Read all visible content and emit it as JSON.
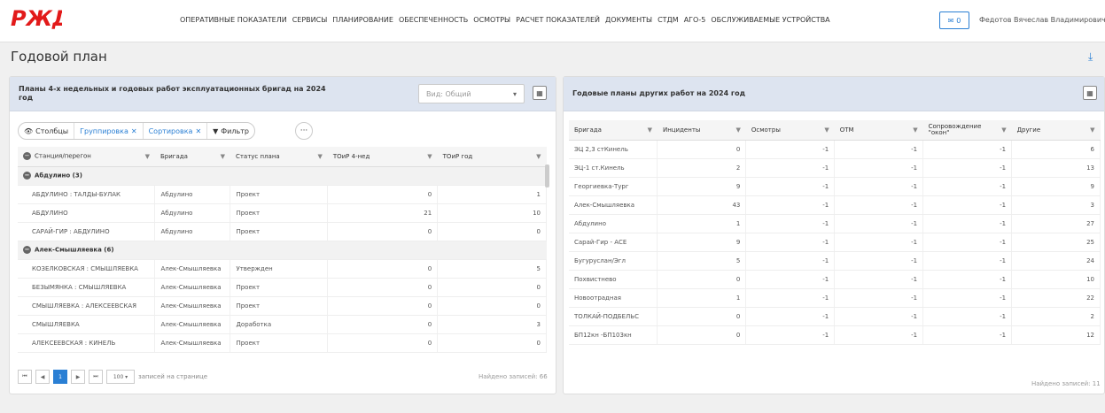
{
  "header": {
    "logo_text": "РЖД",
    "nav": [
      "ОПЕРАТИВНЫЕ ПОКАЗАТЕЛИ",
      "СЕРВИСЫ",
      "ПЛАНИРОВАНИЕ",
      "ОБЕСПЕЧЕННОСТЬ",
      "ОСМОТРЫ",
      "РАСЧЕТ ПОКАЗАТЕЛЕЙ",
      "ДОКУМЕНТЫ",
      "СТДМ",
      "АГО-5",
      "ОБСЛУЖИВАЕМЫЕ УСТРОЙСТВА"
    ],
    "mail_count": "0",
    "user": "Федотов Вячеслав Владимирович"
  },
  "page": {
    "title": "Годовой план"
  },
  "left": {
    "title": "Планы 4-х недельных и годовых работ эксплуатационных бригад на 2024 год",
    "view_placeholder": "Вид: Общий",
    "toolbar": {
      "columns": "Столбцы",
      "grouping": "Группировка",
      "sorting": "Сортировка",
      "filter": "Фильтр",
      "more": "···"
    },
    "headers": [
      "Станция/перегон",
      "Бригада",
      "Статус плана",
      "ТОиР 4-нед",
      "ТОиР год"
    ],
    "groups": [
      {
        "label": "Абдулино (3)",
        "rows": [
          [
            "АБДУЛИНО : ТАЛДЫ-БУЛАК",
            "Абдулино",
            "Проект",
            "0",
            "1"
          ],
          [
            "АБДУЛИНО",
            "Абдулино",
            "Проект",
            "21",
            "10"
          ],
          [
            "САРАЙ-ГИР : АБДУЛИНО",
            "Абдулино",
            "Проект",
            "0",
            "0"
          ]
        ]
      },
      {
        "label": "Алек-Смышляевка (6)",
        "rows": [
          [
            "КОЗЕЛКОВСКАЯ : СМЫШЛЯЕВКА",
            "Алек-Смышляевка",
            "Утвержден",
            "0",
            "5"
          ],
          [
            "БЕЗЫМЯНКА : СМЫШЛЯЕВКА",
            "Алек-Смышляевка",
            "Проект",
            "0",
            "0"
          ],
          [
            "СМЫШЛЯЕВКА : АЛЕКСЕЕВСКАЯ",
            "Алек-Смышляевка",
            "Проект",
            "0",
            "0"
          ],
          [
            "СМЫШЛЯЕВКА",
            "Алек-Смышляевка",
            "Доработка",
            "0",
            "3"
          ],
          [
            "АЛЕКСЕЕВСКАЯ : КИНЕЛЬ",
            "Алек-Смышляевка",
            "Проект",
            "0",
            "0"
          ]
        ]
      }
    ],
    "pager": {
      "page": "1",
      "size": "100",
      "size_label": "записей на странице"
    },
    "found": "Найдено записей: 66"
  },
  "right": {
    "title": "Годовые планы других работ на 2024 год",
    "headers": [
      "Бригада",
      "Инциденты",
      "Осмотры",
      "ОТМ",
      "Сопровождение \"окон\"",
      "Другие"
    ],
    "rows": [
      [
        "ЭЦ 2,3 стКинель",
        "0",
        "-1",
        "-1",
        "-1",
        "6"
      ],
      [
        "ЭЦ-1 ст.Кинель",
        "2",
        "-1",
        "-1",
        "-1",
        "13"
      ],
      [
        "Георгиевка-Тург",
        "9",
        "-1",
        "-1",
        "-1",
        "9"
      ],
      [
        "Алек-Смышляевка",
        "43",
        "-1",
        "-1",
        "-1",
        "3"
      ],
      [
        "Абдулино",
        "1",
        "-1",
        "-1",
        "-1",
        "27"
      ],
      [
        "Сарай-Гир - АСЕ",
        "9",
        "-1",
        "-1",
        "-1",
        "25"
      ],
      [
        "Бугуруслан/Эгл",
        "5",
        "-1",
        "-1",
        "-1",
        "24"
      ],
      [
        "Похвистнево",
        "0",
        "-1",
        "-1",
        "-1",
        "10"
      ],
      [
        "Новоотрадная",
        "1",
        "-1",
        "-1",
        "-1",
        "22"
      ],
      [
        "ТОЛКАЙ-ПОДБЕЛЬС",
        "0",
        "-1",
        "-1",
        "-1",
        "2"
      ],
      [
        "БП12кн -БП103кн",
        "0",
        "-1",
        "-1",
        "-1",
        "12"
      ]
    ],
    "found": "Найдено записей: 11"
  }
}
